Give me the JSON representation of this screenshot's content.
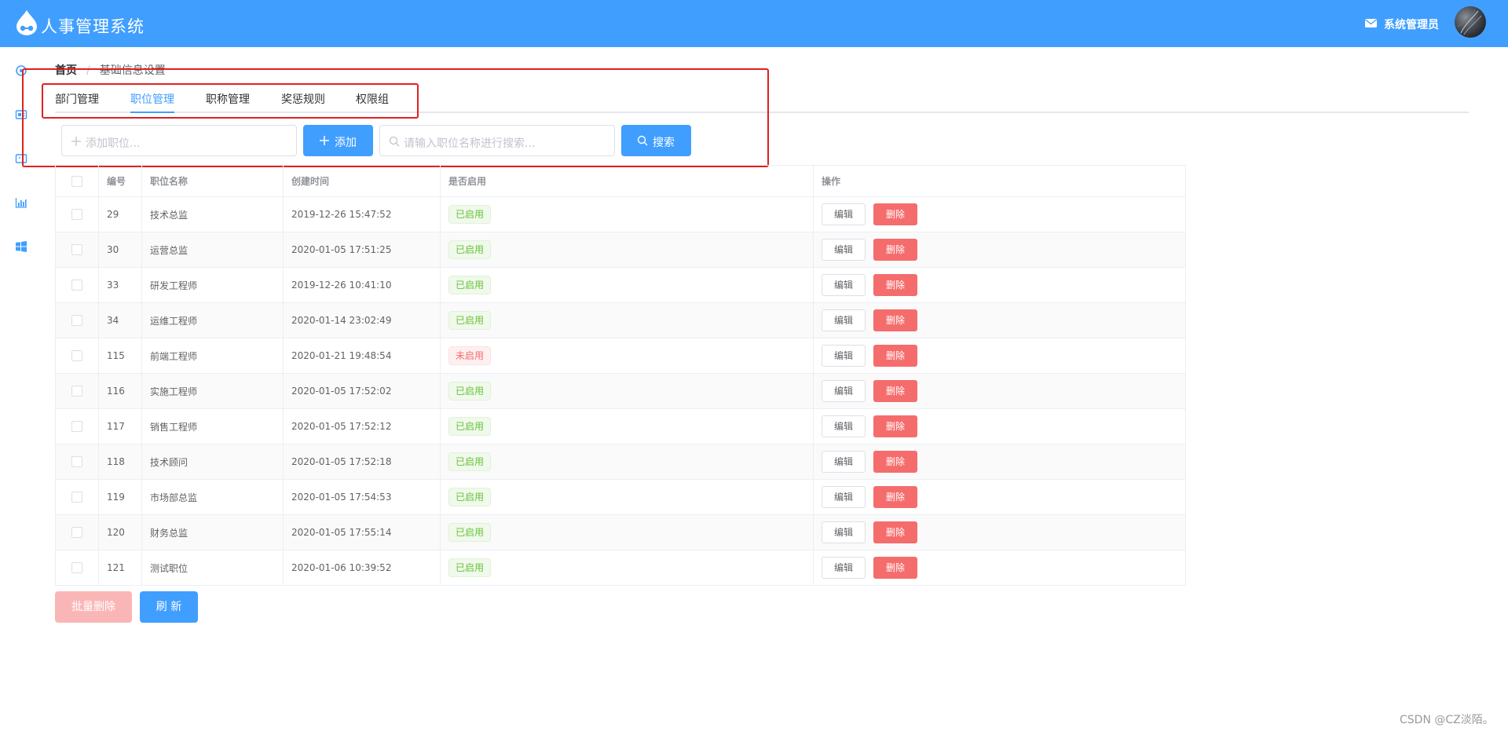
{
  "header": {
    "app_title": "人事管理系统",
    "admin_name": "系统管理员",
    "logo_icon": "drop-logo-icon",
    "mail_icon": "envelope-icon",
    "bg_color": "#409eff"
  },
  "sidebar": {
    "icons": [
      "circle-icon",
      "card-icon",
      "screen-icon",
      "bar-chart-icon",
      "windows-icon"
    ]
  },
  "breadcrumb": {
    "home": "首页",
    "separator": "/",
    "current": "基础信息设置"
  },
  "tabs": [
    {
      "label": "部门管理",
      "active": false
    },
    {
      "label": "职位管理",
      "active": true
    },
    {
      "label": "职称管理",
      "active": false
    },
    {
      "label": "奖惩规则",
      "active": false
    },
    {
      "label": "权限组",
      "active": false
    }
  ],
  "toolbar": {
    "add_placeholder": "添加职位...",
    "add_button": "添加",
    "search_placeholder": "请输入职位名称进行搜索...",
    "search_button": "搜索"
  },
  "table": {
    "columns": [
      "编号",
      "职位名称",
      "创建时间",
      "是否启用",
      "操作"
    ],
    "rows": [
      {
        "id": "29",
        "name": "技术总监",
        "created": "2019-12-26 15:47:52",
        "status": "已启用",
        "enabled": true
      },
      {
        "id": "30",
        "name": "运营总监",
        "created": "2020-01-05 17:51:25",
        "status": "已启用",
        "enabled": true
      },
      {
        "id": "33",
        "name": "研发工程师",
        "created": "2019-12-26 10:41:10",
        "status": "已启用",
        "enabled": true
      },
      {
        "id": "34",
        "name": "运维工程师",
        "created": "2020-01-14 23:02:49",
        "status": "已启用",
        "enabled": true
      },
      {
        "id": "115",
        "name": "前端工程师",
        "created": "2020-01-21 19:48:54",
        "status": "未启用",
        "enabled": false
      },
      {
        "id": "116",
        "name": "实施工程师",
        "created": "2020-01-05 17:52:02",
        "status": "已启用",
        "enabled": true
      },
      {
        "id": "117",
        "name": "销售工程师",
        "created": "2020-01-05 17:52:12",
        "status": "已启用",
        "enabled": true
      },
      {
        "id": "118",
        "name": "技术顾问",
        "created": "2020-01-05 17:52:18",
        "status": "已启用",
        "enabled": true
      },
      {
        "id": "119",
        "name": "市场部总监",
        "created": "2020-01-05 17:54:53",
        "status": "已启用",
        "enabled": true
      },
      {
        "id": "120",
        "name": "财务总监",
        "created": "2020-01-05 17:55:14",
        "status": "已启用",
        "enabled": true
      },
      {
        "id": "121",
        "name": "测试职位",
        "created": "2020-01-06 10:39:52",
        "status": "已启用",
        "enabled": true
      }
    ],
    "edit_label": "编辑",
    "delete_label": "删除"
  },
  "footer": {
    "batch_delete": "批量删除",
    "refresh": "刷 新"
  },
  "watermark": "CSDN @CZ淡陌。",
  "colors": {
    "primary": "#409eff",
    "danger": "#f56c6c",
    "success": "#67c23a",
    "annotation": "#e02020"
  }
}
